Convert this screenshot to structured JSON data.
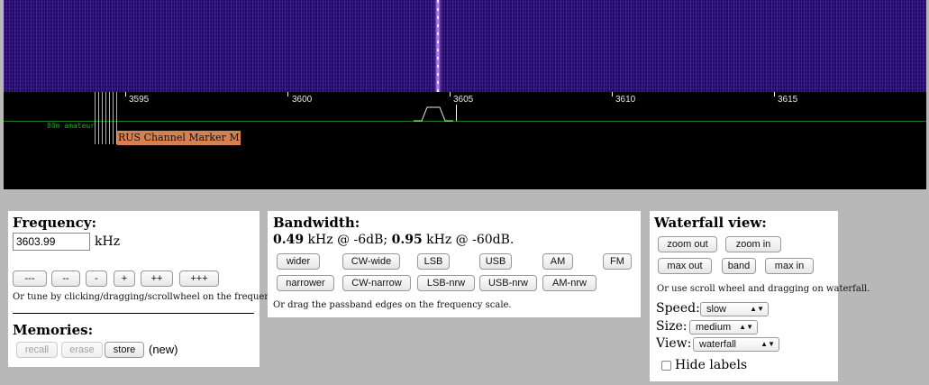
{
  "scale": {
    "ticks": [
      "3595",
      "3600",
      "3605",
      "3610",
      "3615"
    ],
    "band_label": "80m amateur",
    "marker_label": "RUS Channel Marker M"
  },
  "frequency": {
    "title": "Frequency:",
    "value": "3603.99",
    "unit": "kHz",
    "step_buttons": [
      "---",
      "--",
      "-",
      "+",
      "++",
      "+++"
    ],
    "hint": "Or tune by clicking/dragging/scrollwheel on the frequency scale."
  },
  "memories": {
    "title": "Memories:",
    "recall": "recall",
    "erase": "erase",
    "store": "store",
    "status": "(new)"
  },
  "bandwidth": {
    "title": "Bandwidth:",
    "bw6": "0.49",
    "text1": " kHz @ -6dB; ",
    "bw60": "0.95",
    "text2": " kHz @ -60dB.",
    "row1": [
      "wider",
      "CW-wide",
      "LSB",
      "USB",
      "AM",
      "FM"
    ],
    "row2": [
      "narrower",
      "CW-narrow",
      "LSB-nrw",
      "USB-nrw",
      "AM-nrw"
    ],
    "hint": "Or drag the passband edges on the frequency scale."
  },
  "waterfall_view": {
    "title": "Waterfall view:",
    "zoom_out": "zoom out",
    "zoom_in": "zoom in",
    "max_out": "max out",
    "band": "band",
    "max_in": "max in",
    "hint": "Or use scroll wheel and dragging on waterfall.",
    "speed_label": "Speed:",
    "speed_value": "slow",
    "size_label": "Size:",
    "size_value": "medium",
    "view_label": "View:",
    "view_value": "waterfall",
    "hide_labels": "Hide labels",
    "hide_labels_checked": false
  }
}
